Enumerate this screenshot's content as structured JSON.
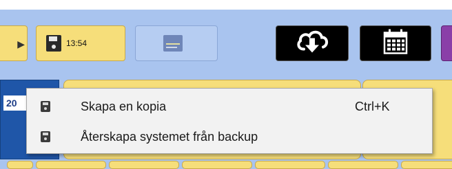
{
  "toolbar": {
    "save_time": "13:54"
  },
  "row": {
    "left_number": "20"
  },
  "context_menu": {
    "items": [
      {
        "label": "Skapa en kopia",
        "shortcut": "Ctrl+K",
        "icon": "floppy-disk-icon"
      },
      {
        "label": "Återskapa systemet från backup",
        "shortcut": "",
        "icon": "floppy-disk-icon"
      }
    ]
  },
  "colors": {
    "background": "#a9c4ef",
    "yellow_button": "#f6de7a",
    "dark_button": "#000000",
    "purple_button": "#8a3fa8",
    "cell_blue": "#1f56a8",
    "menu_bg": "#f2f2f2"
  }
}
